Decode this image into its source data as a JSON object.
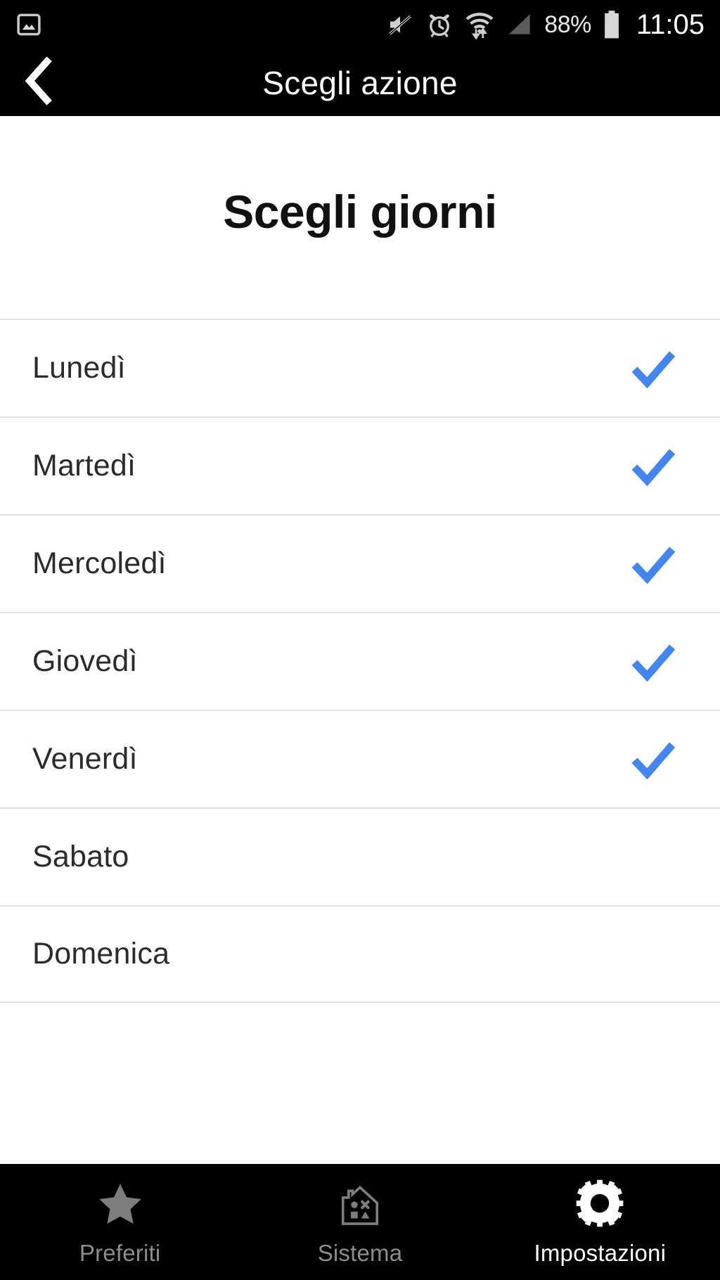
{
  "status_bar": {
    "notification_icon": "image-notification-icon",
    "icons": [
      "mute-icon",
      "alarm-icon",
      "wifi-data-icon",
      "cell-signal-icon"
    ],
    "battery_percent": "88%",
    "battery_icon": "battery-icon",
    "clock": "11:05"
  },
  "app_bar": {
    "back_icon": "back-chevron-icon",
    "title": "Scegli azione"
  },
  "main": {
    "page_title": "Scegli giorni",
    "check_color": "#4285F4",
    "days": [
      {
        "label": "Lunedì",
        "checked": true
      },
      {
        "label": "Martedì",
        "checked": true
      },
      {
        "label": "Mercoledì",
        "checked": true
      },
      {
        "label": "Giovedì",
        "checked": true
      },
      {
        "label": "Venerdì",
        "checked": true
      },
      {
        "label": "Sabato",
        "checked": false
      },
      {
        "label": "Domenica",
        "checked": false
      }
    ]
  },
  "bottom_nav": {
    "items": [
      {
        "label": "Preferiti",
        "icon": "star-icon",
        "active": false
      },
      {
        "label": "Sistema",
        "icon": "house-shapes-icon",
        "active": false
      },
      {
        "label": "Impostazioni",
        "icon": "gear-icon",
        "active": true
      }
    ]
  }
}
